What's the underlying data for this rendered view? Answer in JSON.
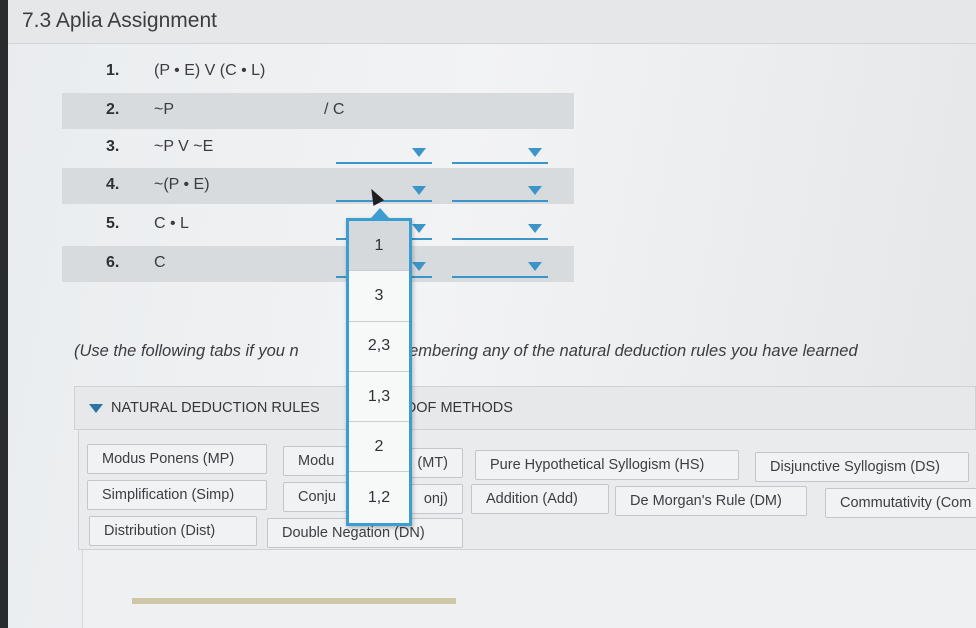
{
  "assignment": {
    "title": "7.3 Aplia Assignment"
  },
  "proof": {
    "rows": [
      {
        "num": "1.",
        "formula": "(P • E) V (C • L)"
      },
      {
        "num": "2.",
        "formula": "~P",
        "conclusion": "/ C"
      },
      {
        "num": "3.",
        "formula": "~P V ~E"
      },
      {
        "num": "4.",
        "formula": "~(P • E)"
      },
      {
        "num": "5.",
        "formula": "C • L"
      },
      {
        "num": "6.",
        "formula": "C"
      }
    ]
  },
  "dropdown": {
    "options": [
      "1",
      "3",
      "2,3",
      "1,3",
      "2",
      "1,2"
    ],
    "hovered": "1"
  },
  "hint": {
    "left": "(Use the following tabs if you n",
    "right": "remembering any of the natural deduction rules you have learned"
  },
  "tabs": {
    "natural_deduction": "NATURAL DEDUCTION RULES",
    "proof_methods_visible": "OOF METHODS"
  },
  "rules": [
    "Modus Ponens (MP)",
    "Modu",
    "(MT)",
    "Pure Hypothetical Syllogism (HS)",
    "Disjunctive Syllogism (DS)",
    "Simplification (Simp)",
    "Conju",
    "onj)",
    "Addition (Add)",
    "De Morgan's Rule (DM)",
    "Commutativity (Com",
    "Distribution (Dist)",
    "Double Negation (DN)"
  ],
  "colors": {
    "accent": "#3b9dd2",
    "row_shade": "#d8dbde"
  }
}
